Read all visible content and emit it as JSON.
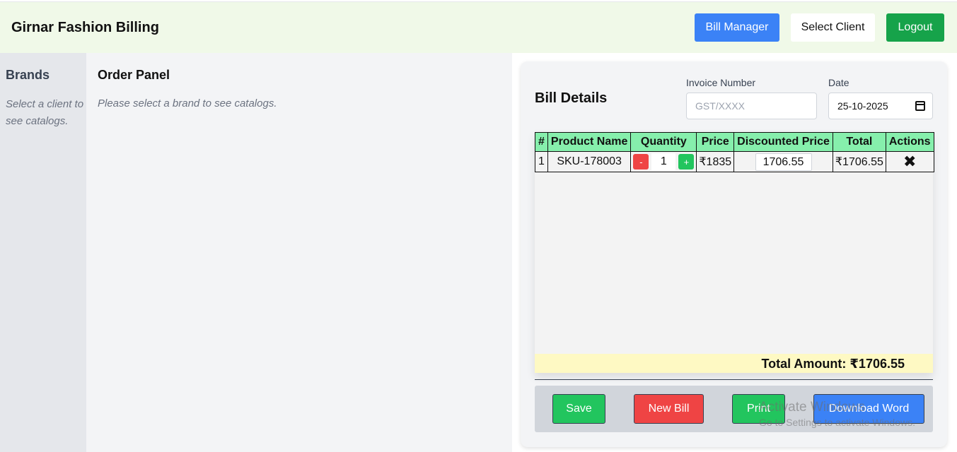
{
  "header": {
    "title": "Girnar Fashion Billing",
    "bill_manager": "Bill Manager",
    "select_client": "Select Client",
    "logout": "Logout"
  },
  "brands": {
    "title": "Brands",
    "message": "Select a client to see catalogs."
  },
  "order_panel": {
    "title": "Order Panel",
    "message": "Please select a brand to see catalogs."
  },
  "bill": {
    "title": "Bill Details",
    "invoice_label": "Invoice Number",
    "invoice_placeholder": "GST/XXXX",
    "date_label": "Date",
    "date_value": "25-10-2025",
    "columns": [
      "#",
      "Product Name",
      "Quantity",
      "Price",
      "Discounted Price",
      "Total",
      "Actions"
    ],
    "rows": [
      {
        "index": "1",
        "product": "SKU-178003",
        "qty_minus": "-",
        "quantity": "1",
        "qty_plus": "+",
        "price": "₹1835",
        "discounted_price": "1706.55",
        "total": "₹1706.55",
        "action_icon": "close-icon"
      }
    ],
    "total_amount": "Total Amount: ₹1706.55",
    "buttons": {
      "save": "Save",
      "new_bill": "New Bill",
      "print": "Print",
      "download_word": "Download Word"
    }
  },
  "watermark": {
    "line1": "Activate Windows",
    "line2": "Go to Settings to activate Windows."
  },
  "colors": {
    "header_bg": "#f0f9e8",
    "primary_blue": "#3b82f6",
    "green": "#22c55e",
    "logout_green": "#16a34a",
    "red": "#ef4444",
    "table_header": "#86efac",
    "total_bar": "#fef9c3"
  }
}
